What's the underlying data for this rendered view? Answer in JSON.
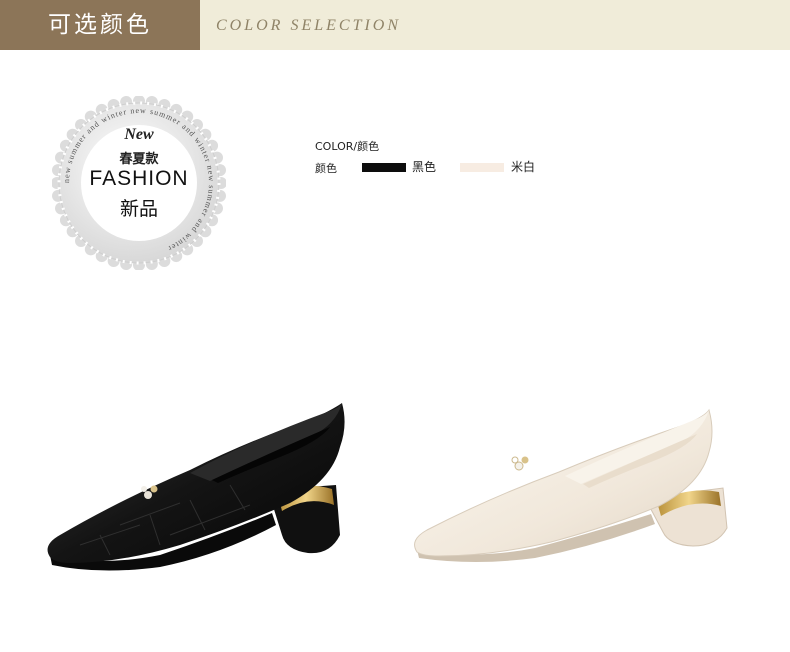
{
  "header": {
    "title_cn": "可选颜色",
    "title_en": "COLOR SELECTION"
  },
  "badge": {
    "script": "New",
    "line_cn": "春夏款",
    "line_en": "FASHION",
    "line_cn2": "新品",
    "ring_text": "new summer and winter new summer and winter new summer and winter"
  },
  "colors": {
    "title": "COLOR/颜色",
    "row_label": "颜色",
    "options": [
      {
        "name": "黑色",
        "hex": "#0d0d0d"
      },
      {
        "name": "米白",
        "hex": "#f7ece2"
      }
    ]
  },
  "products": [
    {
      "icon": "black-shoe-image",
      "color": "#1a1a1a"
    },
    {
      "icon": "white-shoe-image",
      "color": "#f6efe6"
    }
  ],
  "theme": {
    "header_dark": "#8c7558",
    "header_light": "#f0ecd9"
  }
}
